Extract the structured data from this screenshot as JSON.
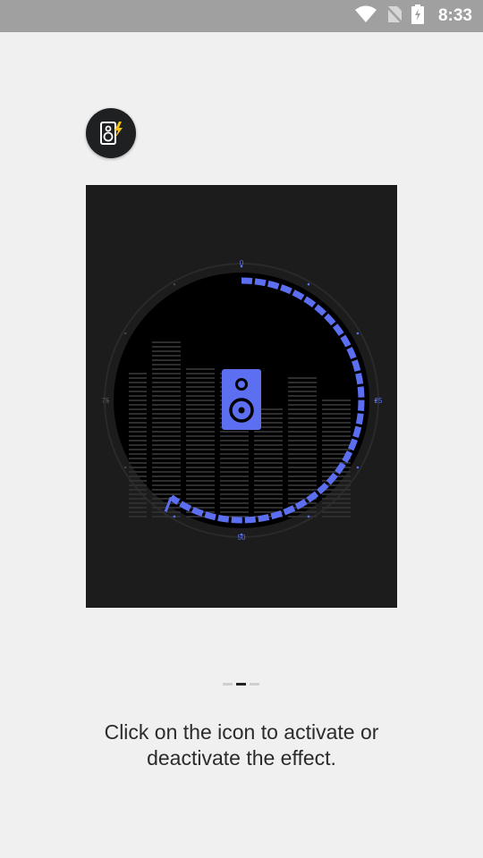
{
  "status_bar": {
    "time": "8:33",
    "icons": [
      "wifi-icon",
      "no-sim-icon",
      "battery-charging-icon"
    ]
  },
  "app_icon": {
    "name": "speaker-boost-icon"
  },
  "preview": {
    "gauge_labels": {
      "top": "0",
      "right": "25",
      "bottom": "50",
      "left": "75"
    },
    "level_fraction": 0.6,
    "accent_color": "#5b6ff0"
  },
  "pager": {
    "pages": 3,
    "current": 2
  },
  "instruction": {
    "line1": "Click on the icon to activate or",
    "line2": "deactivate the effect."
  },
  "colors": {
    "background": "#f0f0f0",
    "status_bar": "#a0a0a0",
    "preview_bg": "#1c1c1c",
    "accent": "#5b6ff0"
  }
}
